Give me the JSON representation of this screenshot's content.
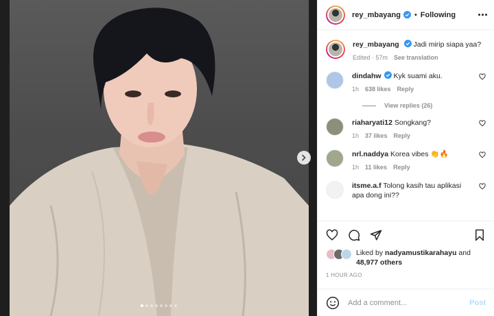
{
  "post": {
    "username": "rey_mbayang",
    "separator": "•",
    "follow_status": "Following",
    "caption_user": "rey_mbayang",
    "caption_text": "Jadi mirip siapa yaa?",
    "caption_edited": "Edited · 57m",
    "see_translation": "See translation",
    "carousel_dots": 8,
    "carousel_active": 1
  },
  "comments": [
    {
      "user": "dindahw",
      "verified": true,
      "text": "Kyk suami aku.",
      "time": "1h",
      "likes": "638 likes",
      "reply": "Reply",
      "avatar_color": "#aec7e8"
    },
    {
      "user": "riaharyati12",
      "verified": false,
      "text": "Songkang?",
      "time": "1h",
      "likes": "37 likes",
      "reply": "Reply",
      "avatar_color": "#8c8f7a"
    },
    {
      "user": "nrl.naddya",
      "verified": false,
      "text": "Korea vibes 👏🔥",
      "time": "1h",
      "likes": "11 likes",
      "reply": "Reply",
      "avatar_color": "#9fa88d"
    },
    {
      "user": "itsme.a.f",
      "verified": false,
      "text": "Tolong kasih tau aplikasi apa dong ini??",
      "avatar_color": "#f2f2f2"
    }
  ],
  "view_replies": "View replies (26)",
  "likes": {
    "prefix": "Liked by",
    "user": "nadyamustikarahayu",
    "and": "and",
    "count": "48,977 others"
  },
  "time_ago": "1 HOUR AGO",
  "add_comment": {
    "placeholder": "Add a comment...",
    "post_label": "Post"
  },
  "colors": {
    "verified": "#3897f0",
    "post_disabled": "#b2dffc",
    "meta_gray": "#8e8e8e"
  }
}
